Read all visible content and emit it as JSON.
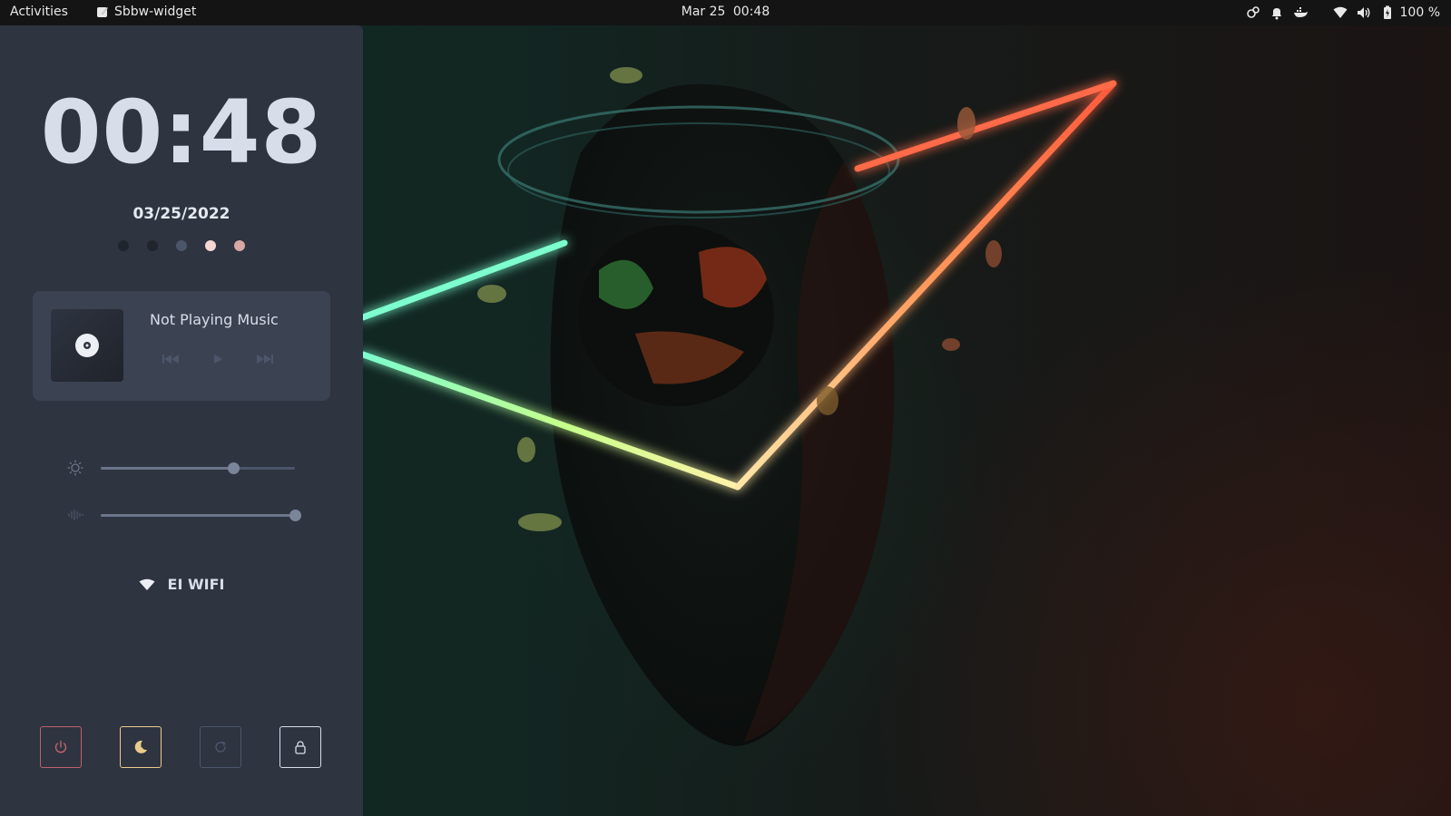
{
  "topbar": {
    "activities": "Activities",
    "app_name": "Sbbw-widget",
    "app_icon": "app-pen-icon",
    "date": "Mar 25",
    "time": "00:48",
    "tray_icons": [
      "network-share-icon",
      "bell-icon",
      "docker-whale-icon",
      "wifi-icon",
      "volume-icon",
      "battery-icon"
    ],
    "battery_label": "100 %"
  },
  "widget": {
    "clock": "00:48",
    "date": "03/25/2022",
    "dots": [
      {
        "color": "#20242c"
      },
      {
        "color": "#20242c"
      },
      {
        "color": "#4c566a"
      },
      {
        "color": "#f4d7d3"
      },
      {
        "color": "#d7a9a4"
      }
    ],
    "music": {
      "title": "Not Playing Music",
      "album_icon": "disc-icon",
      "controls": [
        "previous-icon",
        "play-icon",
        "next-icon"
      ]
    },
    "brightness": {
      "icon": "sun-icon",
      "level": 0.68
    },
    "volume": {
      "icon": "soundwave-icon",
      "level": 1.0
    },
    "wifi": {
      "icon": "wifi-icon",
      "ssid": "EI WIFI"
    },
    "power_buttons": [
      {
        "name": "shutdown",
        "icon": "power-icon",
        "color": "#bf616a"
      },
      {
        "name": "suspend",
        "icon": "moon-icon",
        "color": "#ebcb8b"
      },
      {
        "name": "reboot",
        "icon": "reload-icon",
        "color": "#4c566a"
      },
      {
        "name": "lock",
        "icon": "lock-icon",
        "color": "#d8dee9"
      }
    ]
  }
}
